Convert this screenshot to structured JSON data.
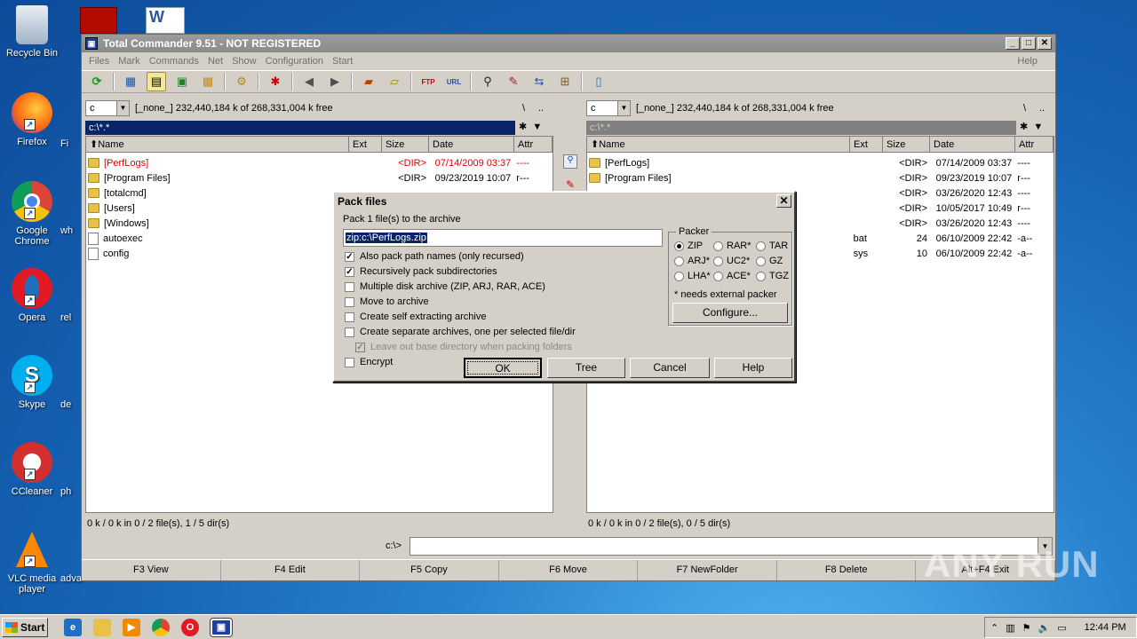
{
  "desktop": {
    "icons": [
      {
        "label": "Recycle Bin",
        "icon": "recycle-bin-icon"
      },
      {
        "label": "Firefox",
        "icon": "firefox-icon"
      },
      {
        "label": "Google Chrome",
        "icon": "chrome-icon"
      },
      {
        "label": "Opera",
        "icon": "opera-icon"
      },
      {
        "label": "Skype",
        "icon": "skype-icon"
      },
      {
        "label": "CCleaner",
        "icon": "ccleaner-icon"
      },
      {
        "label": "VLC media player",
        "icon": "vlc-icon"
      }
    ],
    "partial_labels": [
      "Fi",
      "wh",
      "rel",
      "de",
      "ph",
      "adva"
    ]
  },
  "window": {
    "title": "Total Commander 9.51 - NOT REGISTERED",
    "menu": [
      "Files",
      "Mark",
      "Commands",
      "Net",
      "Show",
      "Configuration",
      "Start"
    ],
    "help": "Help",
    "left": {
      "drive": "c",
      "drive_info": "[_none_]  232,440,184 k of 268,331,004 k free",
      "root": "\\",
      "up": "..",
      "path": "c:\\*.*",
      "columns": [
        "Name",
        "Ext",
        "Size",
        "Date",
        "Attr"
      ],
      "files": [
        {
          "name": "[PerfLogs]",
          "ext": "",
          "size": "<DIR>",
          "date": "07/14/2009 03:37",
          "attr": "----",
          "type": "folder",
          "color": "#e00000"
        },
        {
          "name": "[Program Files]",
          "ext": "",
          "size": "<DIR>",
          "date": "09/23/2019 10:07",
          "attr": "r---",
          "type": "folder",
          "color": "#000000"
        },
        {
          "name": "[totalcmd]",
          "ext": "",
          "size": "",
          "date": "",
          "attr": "",
          "type": "folder",
          "color": "#000000"
        },
        {
          "name": "[Users]",
          "ext": "",
          "size": "",
          "date": "",
          "attr": "",
          "type": "folder",
          "color": "#000000"
        },
        {
          "name": "[Windows]",
          "ext": "",
          "size": "",
          "date": "",
          "attr": "",
          "type": "folder",
          "color": "#000000"
        },
        {
          "name": "autoexec",
          "ext": "",
          "size": "",
          "date": "",
          "attr": "",
          "type": "file",
          "color": "#000000"
        },
        {
          "name": "config",
          "ext": "",
          "size": "",
          "date": "",
          "attr": "",
          "type": "file",
          "color": "#000000"
        }
      ],
      "status": "0 k / 0 k in 0 / 2 file(s), 1 / 5 dir(s)"
    },
    "right": {
      "drive": "c",
      "drive_info": "[_none_]  232,440,184 k of 268,331,004 k free",
      "root": "\\",
      "up": "..",
      "path": "c:\\*.*",
      "columns": [
        "Name",
        "Ext",
        "Size",
        "Date",
        "Attr"
      ],
      "files": [
        {
          "name": "[PerfLogs]",
          "ext": "",
          "size": "<DIR>",
          "date": "07/14/2009 03:37",
          "attr": "----",
          "type": "folder"
        },
        {
          "name": "[Program Files]",
          "ext": "",
          "size": "<DIR>",
          "date": "09/23/2019 10:07",
          "attr": "r---",
          "type": "folder"
        },
        {
          "name": "",
          "ext": "",
          "size": "<DIR>",
          "date": "03/26/2020 12:43",
          "attr": "----",
          "type": "hidden"
        },
        {
          "name": "",
          "ext": "",
          "size": "<DIR>",
          "date": "10/05/2017 10:49",
          "attr": "r---",
          "type": "hidden"
        },
        {
          "name": "",
          "ext": "",
          "size": "<DIR>",
          "date": "03/26/2020 12:43",
          "attr": "----",
          "type": "hidden"
        },
        {
          "name": "",
          "ext": "bat",
          "size": "24",
          "date": "06/10/2009 22:42",
          "attr": "-a--",
          "type": "hidden"
        },
        {
          "name": "",
          "ext": "sys",
          "size": "10",
          "date": "06/10/2009 22:42",
          "attr": "-a--",
          "type": "hidden"
        }
      ],
      "status": "0 k / 0 k in 0 / 2 file(s), 0 / 5 dir(s)"
    },
    "cmdline": {
      "prompt": "c:\\>",
      "value": ""
    },
    "fkeys": [
      "F3 View",
      "F4 Edit",
      "F5 Copy",
      "F6 Move",
      "F7 NewFolder",
      "F8 Delete",
      "Alt+F4 Exit"
    ]
  },
  "dialog": {
    "title": "Pack files",
    "prompt": "Pack 1 file(s) to the archive",
    "archive_path": "zip:c:\\PerfLogs.zip",
    "options": [
      {
        "label": "Also pack path names (only recursed)",
        "checked": true
      },
      {
        "label": "Recursively pack subdirectories",
        "checked": true
      },
      {
        "label": "Multiple disk archive (ZIP, ARJ, RAR, ACE)",
        "checked": false
      },
      {
        "label": "Move to archive",
        "checked": false
      },
      {
        "label": "Create self extracting archive",
        "checked": false
      },
      {
        "label": "Create separate archives, one per selected file/dir",
        "checked": false
      },
      {
        "label": "Leave out base directory when packing folders",
        "checked": true,
        "disabled": true
      },
      {
        "label": "Encrypt",
        "checked": false
      }
    ],
    "packer_label": "Packer",
    "packers": [
      "ZIP",
      "RAR*",
      "TAR",
      "ARJ*",
      "UC2*",
      "GZ",
      "LHA*",
      "ACE*",
      "TGZ"
    ],
    "selected_packer": "ZIP",
    "note": "* needs external packer",
    "configure": "Configure...",
    "buttons": {
      "ok": "OK",
      "tree": "Tree",
      "cancel": "Cancel",
      "help": "Help"
    }
  },
  "taskbar": {
    "start": "Start",
    "clock": "12:44 PM"
  },
  "watermark": "ANY RUN"
}
